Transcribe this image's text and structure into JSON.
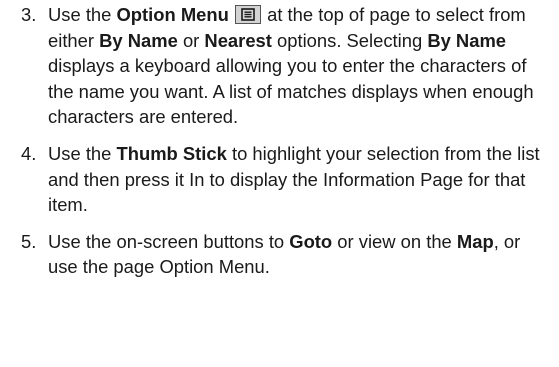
{
  "steps": [
    {
      "number": "3.",
      "t1": "Use the ",
      "b1": "Option Menu",
      "icon": "option-menu-icon",
      "t2": " at the top of page to select from either ",
      "b2": "By Name",
      "t3": " or ",
      "b3": "Nearest",
      "t4": " options. Selecting ",
      "b4": "By Name",
      "t5": " displays a keyboard allowing you to enter the characters of the name you want. A list of matches displays when enough characters are entered."
    },
    {
      "number": "4.",
      "t1": "Use the ",
      "b1": "Thumb Stick",
      "t2": " to highlight your selection from the list and then press it In to display the Information Page for that item."
    },
    {
      "number": "5.",
      "t1": "Use the on-screen buttons to ",
      "b1": "Goto",
      "t2": " or view on the ",
      "b2": "Map",
      "t3": ", or use the page Option Menu."
    }
  ],
  "colors": {
    "text": "#1a1a1a",
    "icon_bg": "#d3d3d3",
    "icon_border": "#555555"
  }
}
